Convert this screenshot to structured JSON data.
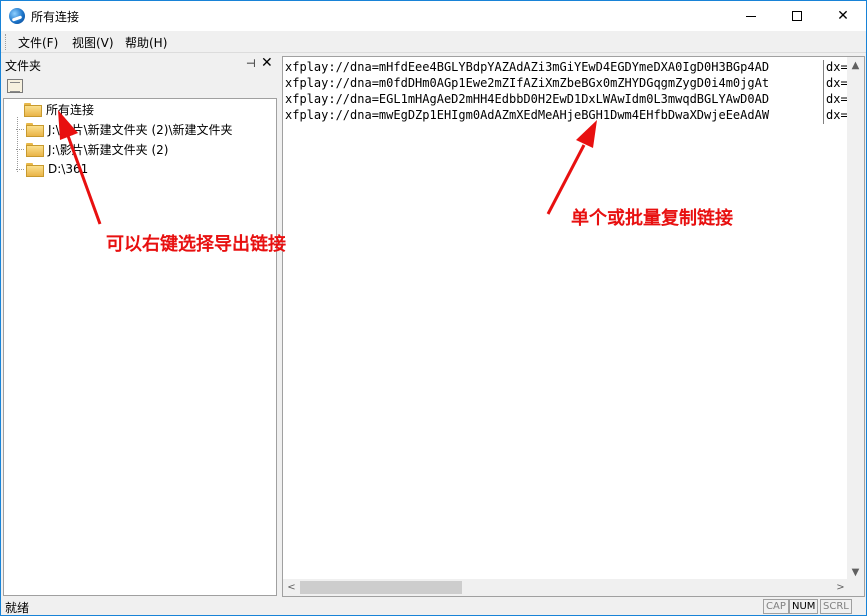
{
  "window": {
    "title": "所有连接"
  },
  "menu": {
    "items": [
      "文件(F)",
      "视图(V)",
      "帮助(H)"
    ]
  },
  "folder_pane": {
    "title": "文件夹",
    "pin_glyph": "⊣",
    "close_glyph": "✕",
    "tree": [
      {
        "label": "所有连接"
      },
      {
        "label": "J:\\影片\\新建文件夹 (2)\\新建文件夹"
      },
      {
        "label": "J:\\影片\\新建文件夹 (2)"
      },
      {
        "label": "D:\\361"
      }
    ]
  },
  "links": {
    "rows": [
      {
        "url": "xfplay://dna=mHfdEee4BGLYBdpYAZAdAZi3mGiYEwD4EGDYmeDXA0IgD0H3BGp4AD",
        "dx": "dx="
      },
      {
        "url": "xfplay://dna=m0fdDHm0AGp1Ewe2mZIfAZiXmZbeBGx0mZHYDGqgmZygD0i4m0jgAt",
        "dx": "dx="
      },
      {
        "url": "xfplay://dna=EGL1mHAgAeD2mHH4EdbbD0H2EwD1DxLWAwIdm0L3mwqdBGLYAwD0AD",
        "dx": "dx="
      },
      {
        "url": "xfplay://dna=mwEgDZp1EHIgm0AdAZmXEdMeAHjeBGH1Dwm4EHfbDwaXDwjeEeAdAW",
        "dx": "dx="
      }
    ]
  },
  "status": {
    "text": "就绪",
    "indicators": [
      "CAP",
      "NUM",
      "SCRL"
    ]
  },
  "annotations": {
    "left": "可以右键选择导出链接",
    "right": "单个或批量复制链接",
    "color": "#e81010"
  },
  "colors": {
    "window_border": "#1883d7",
    "annotation": "#e81010"
  }
}
